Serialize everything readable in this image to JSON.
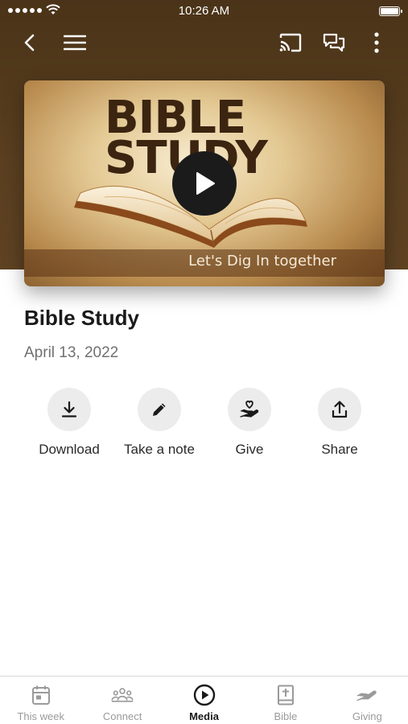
{
  "status_bar": {
    "time": "10:26 AM"
  },
  "top_bar": {
    "back_icon": "chevron-left-icon",
    "menu_icon": "hamburger-menu-icon",
    "cast_icon": "cast-icon",
    "chat_icon": "chat-bubbles-icon",
    "more_icon": "more-vertical-icon"
  },
  "hero": {
    "title_line1": "BIBLE",
    "title_line2": "STUDY",
    "tagline": "Let's Dig In together",
    "play_icon": "play-icon"
  },
  "media": {
    "title": "Bible Study",
    "date": "April 13, 2022"
  },
  "actions": [
    {
      "label": "Download",
      "icon": "download-icon"
    },
    {
      "label": "Take a note",
      "icon": "pencil-icon"
    },
    {
      "label": "Give",
      "icon": "hand-heart-icon"
    },
    {
      "label": "Share",
      "icon": "share-icon"
    }
  ],
  "tabs": [
    {
      "label": "This week",
      "icon": "calendar-icon",
      "active": false
    },
    {
      "label": "Connect",
      "icon": "people-icon",
      "active": false
    },
    {
      "label": "Media",
      "icon": "play-circle-icon",
      "active": true
    },
    {
      "label": "Bible",
      "icon": "bible-icon",
      "active": false
    },
    {
      "label": "Giving",
      "icon": "giving-hand-icon",
      "active": false
    }
  ],
  "colors": {
    "header_brown": "#4a3318",
    "active_tab": "#1a1a1a",
    "inactive_tab": "#9a9a9a",
    "action_circle": "#ececec"
  }
}
